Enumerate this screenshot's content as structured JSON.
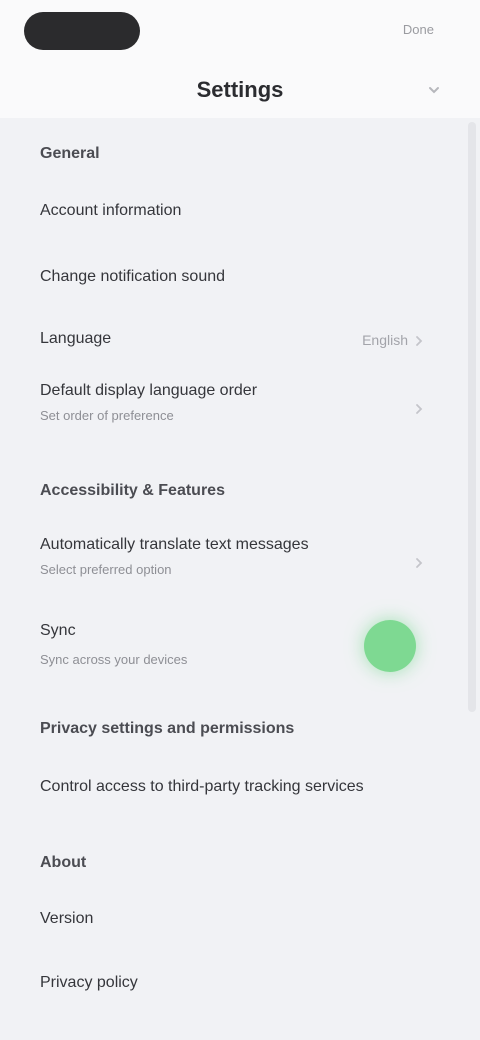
{
  "status_bar": {
    "right_text": "Done"
  },
  "header": {
    "title": "Settings"
  },
  "sections": {
    "general": {
      "title": "General",
      "rows": [
        {
          "label": "Account information"
        },
        {
          "label": "Change notification sound"
        },
        {
          "label": "Language",
          "value": "English"
        },
        {
          "label": "Default display language order",
          "sub": "Set order of preference"
        }
      ]
    },
    "accessibility": {
      "title": "Accessibility & Features",
      "rows": [
        {
          "label": "Automatically translate text messages",
          "sub": "Select preferred option"
        },
        {
          "label": "Sync",
          "sub": "Sync across your devices",
          "toggle": "on"
        }
      ]
    },
    "privacy": {
      "title": "Privacy settings and permissions",
      "rows": [
        {
          "label": "Control access to third-party tracking services"
        }
      ]
    },
    "about": {
      "title": "About",
      "rows": [
        {
          "label": "Version"
        },
        {
          "label": "Privacy policy"
        }
      ]
    }
  },
  "colors": {
    "accent_toggle": "#7ed992",
    "background": "#f1f2f5"
  },
  "icons": {
    "header_action": "chevron-icon",
    "row_chevron": "chevron-right-icon"
  }
}
